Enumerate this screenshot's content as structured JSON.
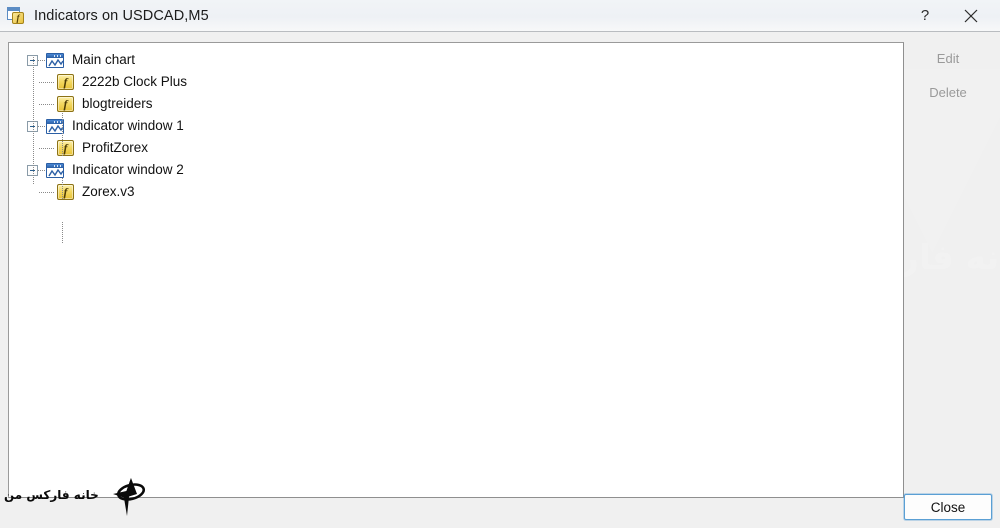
{
  "window": {
    "title": "Indicators on USDCAD,M5",
    "icon": "indicator-window-icon",
    "fx_glyph": "f",
    "help_label": "?",
    "close_glyph": "✕"
  },
  "tree": {
    "nodes": [
      {
        "label": "Main chart",
        "icon": "chart-window-icon",
        "expanded": true,
        "children": [
          {
            "label": "2222b Clock Plus",
            "icon": "fx-indicator-icon"
          },
          {
            "label": "blogtreiders",
            "icon": "fx-indicator-icon"
          }
        ]
      },
      {
        "label": "Indicator window 1",
        "icon": "chart-window-icon",
        "expanded": true,
        "children": [
          {
            "label": "ProfitZorex",
            "icon": "fx-indicator-icon"
          }
        ]
      },
      {
        "label": "Indicator window 2",
        "icon": "chart-window-icon",
        "expanded": true,
        "children": [
          {
            "label": "Zorex.v3",
            "icon": "fx-indicator-icon"
          }
        ]
      }
    ]
  },
  "buttons": {
    "edit": "Edit",
    "delete": "Delete",
    "close": "Close"
  },
  "watermark": {
    "text": "خانه فارکس من",
    "brand_text": "خانه فارکس من"
  },
  "colors": {
    "accent": "#2b5fa5",
    "fx_gold": "#e8c337",
    "focus_border": "#5a9fd4",
    "panel_bg": "#ffffff",
    "dialog_bg": "#f0f0f0",
    "disabled_text": "#9a9a9a"
  }
}
